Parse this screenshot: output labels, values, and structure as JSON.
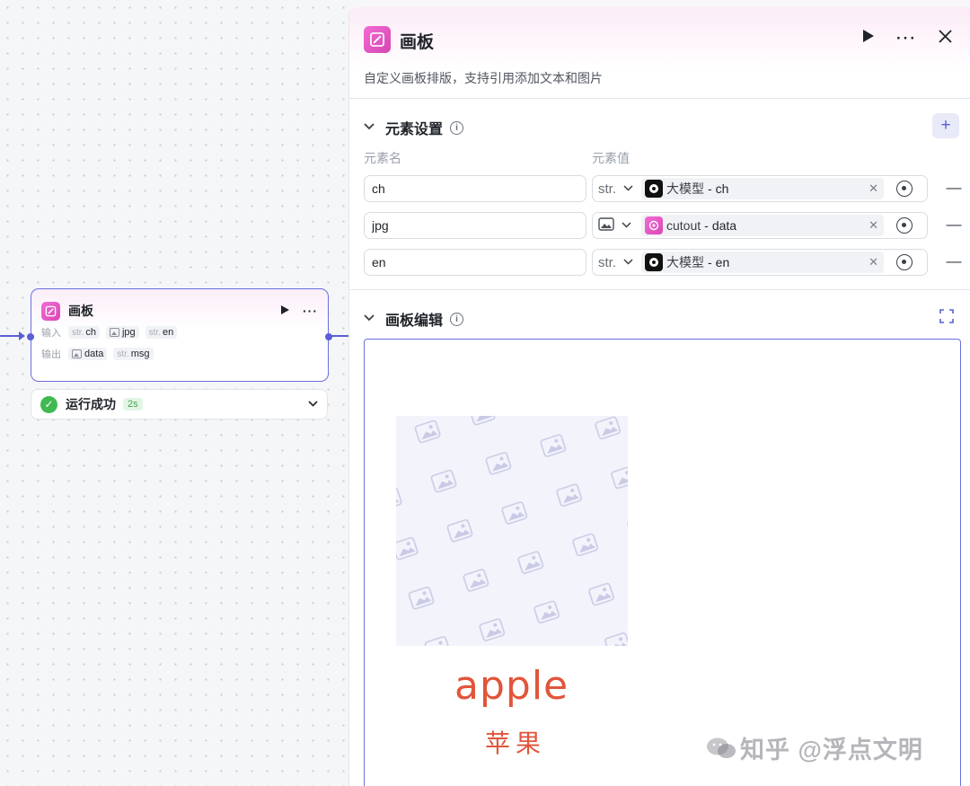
{
  "node": {
    "title": "画板",
    "input_label": "输入",
    "output_label": "输出",
    "inputs": [
      {
        "type": "str.",
        "name": "ch",
        "kind": "text"
      },
      {
        "type": "",
        "name": "jpg",
        "kind": "image"
      },
      {
        "type": "str.",
        "name": "en",
        "kind": "text"
      }
    ],
    "outputs": [
      {
        "type": "",
        "name": "data",
        "kind": "image"
      },
      {
        "type": "str.",
        "name": "msg",
        "kind": "text"
      }
    ]
  },
  "run_status": {
    "text": "运行成功",
    "duration": "2s"
  },
  "panel": {
    "title": "画板",
    "description": "自定义画板排版，支持引用添加文本和图片",
    "settings_title": "元素设置",
    "col_name": "元素名",
    "col_value": "元素值",
    "elements": [
      {
        "name": "ch",
        "type": "str.",
        "kind": "text",
        "source": "大模型",
        "field": "ch",
        "source_kind": "llm"
      },
      {
        "name": "jpg",
        "type": "",
        "kind": "image",
        "source": "cutout",
        "field": "data",
        "source_kind": "plugin"
      },
      {
        "name": "en",
        "type": "str.",
        "kind": "text",
        "source": "大模型",
        "field": "en",
        "source_kind": "llm"
      }
    ],
    "editor_title": "画板编辑",
    "canvas_text_en": "apple",
    "canvas_text_cn": "苹果"
  },
  "watermark": "知乎 @浮点文明",
  "colors": {
    "accent": "#5b5ed6",
    "brand_pink": "#e050c4",
    "success": "#3fb950",
    "apple_orange": "#e1553a"
  }
}
